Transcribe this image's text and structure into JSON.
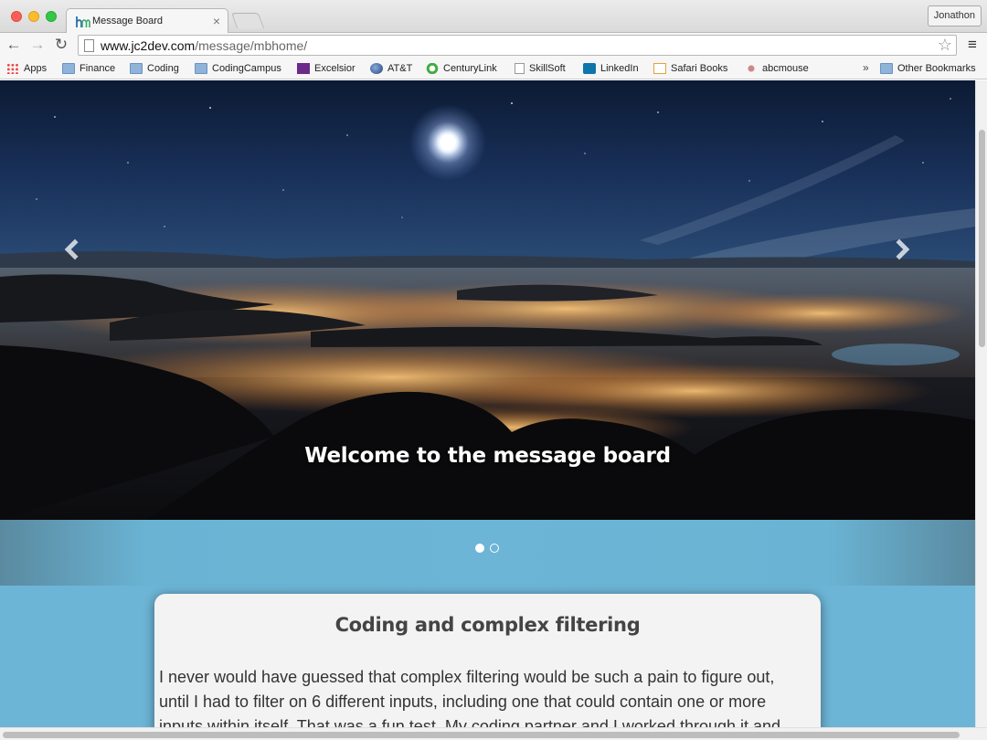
{
  "browser": {
    "tab_title": "Message Board",
    "tab_close": "×",
    "profile_name": "Jonathon",
    "url_host": "www.jc2dev.com",
    "url_path": "/message/mbhome/",
    "back_glyph": "←",
    "forward_glyph": "→",
    "reload_glyph": "↻",
    "star_glyph": "☆",
    "menu_glyph": "≡",
    "bookmarks": [
      {
        "label": "Apps",
        "icon": "apps-icon"
      },
      {
        "label": "Finance",
        "icon": "folder-icon"
      },
      {
        "label": "Coding",
        "icon": "folder-icon"
      },
      {
        "label": "CodingCampus",
        "icon": "folder-icon"
      },
      {
        "label": "Excelsior",
        "icon": "excelsior-icon"
      },
      {
        "label": "AT&T",
        "icon": "att-icon"
      },
      {
        "label": "CenturyLink",
        "icon": "centurylink-icon"
      },
      {
        "label": "SkillSoft",
        "icon": "page-icon"
      },
      {
        "label": "LinkedIn",
        "icon": "linkedin-icon"
      },
      {
        "label": "Safari Books",
        "icon": "safari-books-icon"
      },
      {
        "label": "abcmouse",
        "icon": "abcmouse-icon"
      }
    ],
    "bookmarks_overflow": "»",
    "other_bookmarks": "Other Bookmarks"
  },
  "carousel": {
    "caption": "Welcome to the message board",
    "slide_count": 2,
    "active_slide": 1
  },
  "post": {
    "title": "Coding and complex filtering",
    "body": "I never would have guessed that complex filtering would be such a pain to figure out, until I had to filter on 6 different inputs, including one that could contain one or more inputs within itself. That was a fun test. My coding partner and I worked through it and"
  },
  "colors": {
    "page_background": "#6db5d6",
    "card_background": "#f3f3f3",
    "title_text": "#444444"
  }
}
